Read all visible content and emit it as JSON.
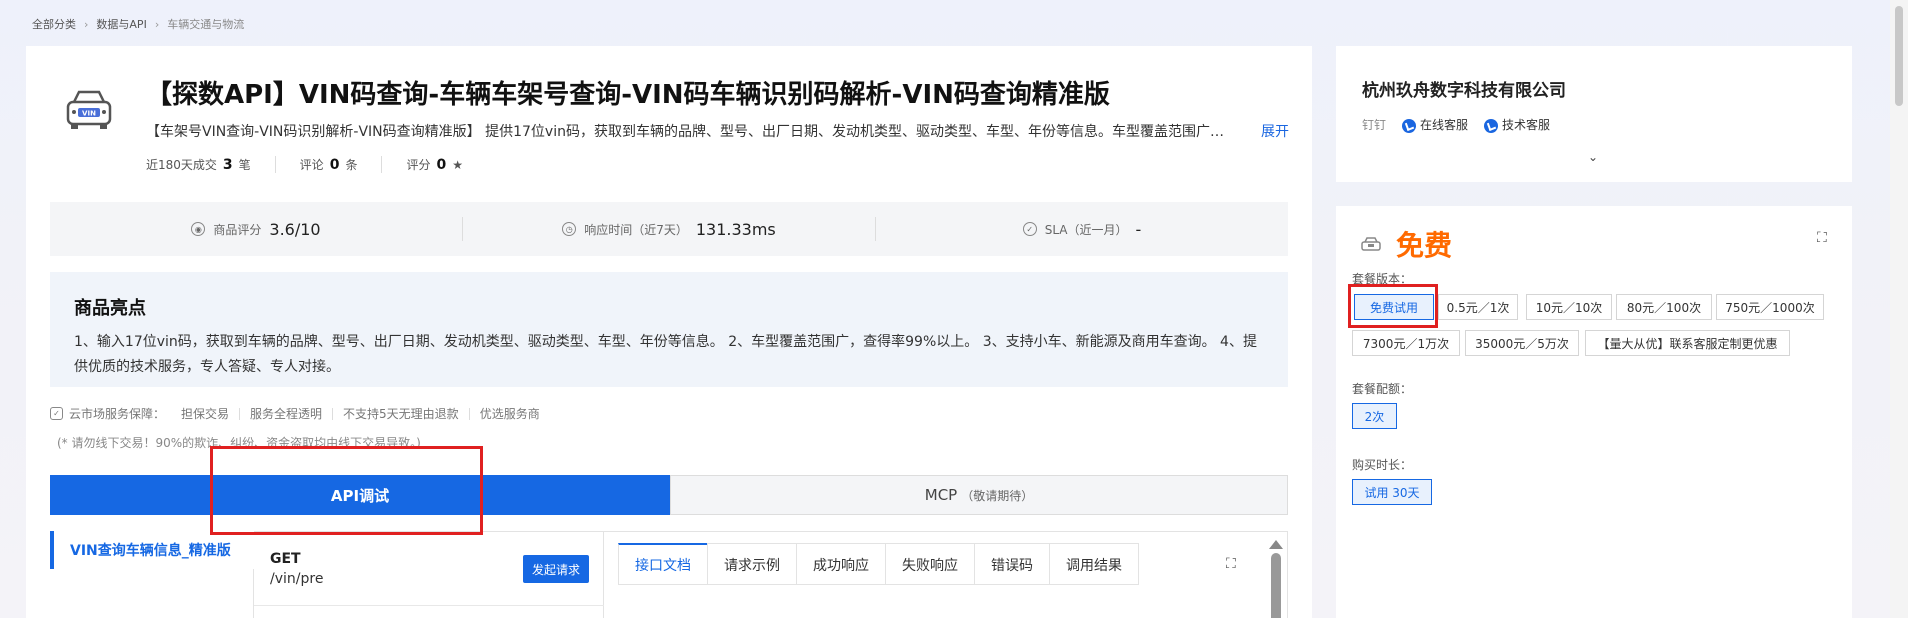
{
  "breadcrumb": [
    "全部分类",
    "数据与API",
    "车辆交通与物流"
  ],
  "product": {
    "title": "【探数API】VIN码查询-车辆车架号查询-VIN码车辆识别码解析-VIN码查询精准版",
    "desc": "【车架号VIN查询-VIN码识别解析-VIN码查询精准版】 提供17位vin码，获取到车辆的品牌、型号、出厂日期、发动机类型、驱动类型、车型、年份等信息。车型覆盖范围广，…",
    "expand": "展开",
    "stats": {
      "deals_label": "近180天成交",
      "deals_val": "3",
      "deals_unit": "笔",
      "reviews_label": "评论",
      "reviews_val": "0",
      "reviews_unit": "条",
      "score_label": "评分",
      "score_val": "0",
      "score_star": "★"
    }
  },
  "metrics": [
    {
      "icon": "rating-icon",
      "label": "商品评分",
      "value": "3.6/10"
    },
    {
      "icon": "clock-icon",
      "label": "响应时间（近7天）",
      "value": "131.33ms"
    },
    {
      "icon": "check-icon",
      "label": "SLA（近一月）",
      "value": "-"
    }
  ],
  "highlight": {
    "title": "商品亮点",
    "text": "1、输入17位vin码，获取到车辆的品牌、型号、出厂日期、发动机类型、驱动类型、车型、年份等信息。 2、车型覆盖范围广，查得率99%以上。 3、支持小车、新能源及商用车查询。 4、提供优质的技术服务，专人答疑、专人对接。"
  },
  "guarantee": {
    "label": "云市场服务保障：",
    "items": [
      "担保交易",
      "服务全程透明",
      "不支持5天无理由退款",
      "优选服务商"
    ],
    "warn": "(* 请勿线下交易！90%的欺诈、纠纷、资金盗取均由线下交易导致。)"
  },
  "tabs": {
    "api": "API调试",
    "mcp": "MCP",
    "mcp_note": "（敬请期待）"
  },
  "api": {
    "left_item": "VIN查询车辆信息_精准版",
    "method": "GET",
    "path": "/vin/pre",
    "go": "发起请求",
    "doc_tabs": [
      "接口文档",
      "请求示例",
      "成功响应",
      "失败响应",
      "错误码",
      "调用结果"
    ]
  },
  "vendor": {
    "company": "杭州玖舟数字科技有限公司",
    "dingtalk": "钉钉",
    "online": "在线客服",
    "tech": "技术客服"
  },
  "pricing": {
    "price": "免费",
    "version_label": "套餐版本：",
    "versions": [
      "免费试用",
      "0.5元／1次",
      "10元／10次",
      "80元／100次",
      "750元／1000次",
      "7300元／1万次",
      "35000元／5万次",
      "【量大从优】联系客服定制更优惠"
    ],
    "quota_label": "套餐配额：",
    "quota": "2次",
    "duration_label": "购买时长：",
    "duration": "试用 30天"
  },
  "colors": {
    "accent": "#1668e3",
    "price": "#ff6a00",
    "annotation": "#e02020"
  }
}
